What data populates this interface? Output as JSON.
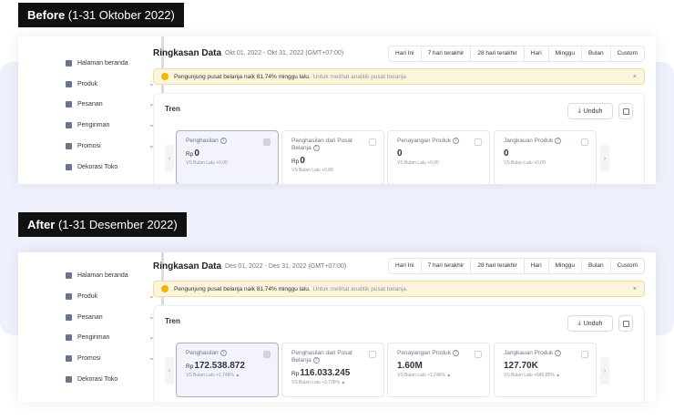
{
  "before": {
    "label_bold": "Before",
    "label_range": " (1-31 Oktober 2022)",
    "header": {
      "title": "Ringkasan Data",
      "date_range": "Okt 01, 2022 - Okt 31, 2022 (GMT+07:00)"
    },
    "alert": {
      "text": "Pengunjung pusat belanja naik 81.74% minggu lalu.",
      "link": "Untuk melihat analitik pusat belanja",
      "close": "×"
    },
    "metrics": [
      {
        "title": "Penghasilan",
        "currency": "Rp",
        "value": "0",
        "vs": "VS Bulan Lalu +0,00"
      },
      {
        "title": "Penghasilan dari Pusat Belanja",
        "currency": "Rp",
        "value": "0",
        "vs": "VS Bulan Lalu +0,00"
      },
      {
        "title": "Penayangan Produk",
        "currency": "",
        "value": "0",
        "vs": "VS Bulan Lalu +0,00"
      },
      {
        "title": "Jangkauan Produk",
        "currency": "",
        "value": "0",
        "vs": "VS Bulan Lalu +0,00"
      }
    ]
  },
  "after": {
    "label_bold": "After",
    "label_range": " (1-31 Desember 2022)",
    "header": {
      "title": "Ringkasan Data",
      "date_range": "Des 01, 2022 - Des 31, 2022 (GMT+07:00)"
    },
    "alert": {
      "text": "Pengunjung pusat belanja naik 81.74% minggu lalu.",
      "link": "Untuk melihat analitik pusat belanja.",
      "close": "×"
    },
    "metrics": [
      {
        "title": "Penghasilan",
        "currency": "Rp",
        "value": "172.538.872",
        "vs": "VS Bulan Lalu +1,748% ▲"
      },
      {
        "title": "Penghasilan dari Pusat Belanja",
        "currency": "Rp",
        "value": "116.033.245",
        "vs": "VS Bulan Lalu +3,736% ▲"
      },
      {
        "title": "Penayangan Produk",
        "currency": "",
        "value": "1.60M",
        "vs": "VS Bulan Lalu +1,246% ▲"
      },
      {
        "title": "Jangkauan Produk",
        "currency": "",
        "value": "127.70K",
        "vs": "VS Bulan Lalu +545,85% ▲"
      }
    ]
  },
  "sidebar": {
    "items": [
      {
        "label": "Halaman beranda",
        "icon": "home-icon"
      },
      {
        "label": "Produk",
        "icon": "product-icon"
      },
      {
        "label": "Pesanan",
        "icon": "order-icon"
      },
      {
        "label": "Pengiriman",
        "icon": "truck-icon"
      },
      {
        "label": "Promosi",
        "icon": "megaphone-icon"
      },
      {
        "label": "Dekorasi Toko",
        "icon": "store-icon"
      }
    ]
  },
  "tabs": [
    "Hari Ini",
    "7 hari terakhir",
    "28 hari terakhir",
    "Hari",
    "Minggu",
    "Bulan",
    "Custom"
  ],
  "card": {
    "title": "Tren",
    "download": "Unduh",
    "download_icon": "download-icon",
    "calendar_icon": "calendar-icon"
  },
  "colors": {
    "accent": "#f5b400",
    "alert_bg": "#fdf5db",
    "band": "#eef1fb"
  }
}
